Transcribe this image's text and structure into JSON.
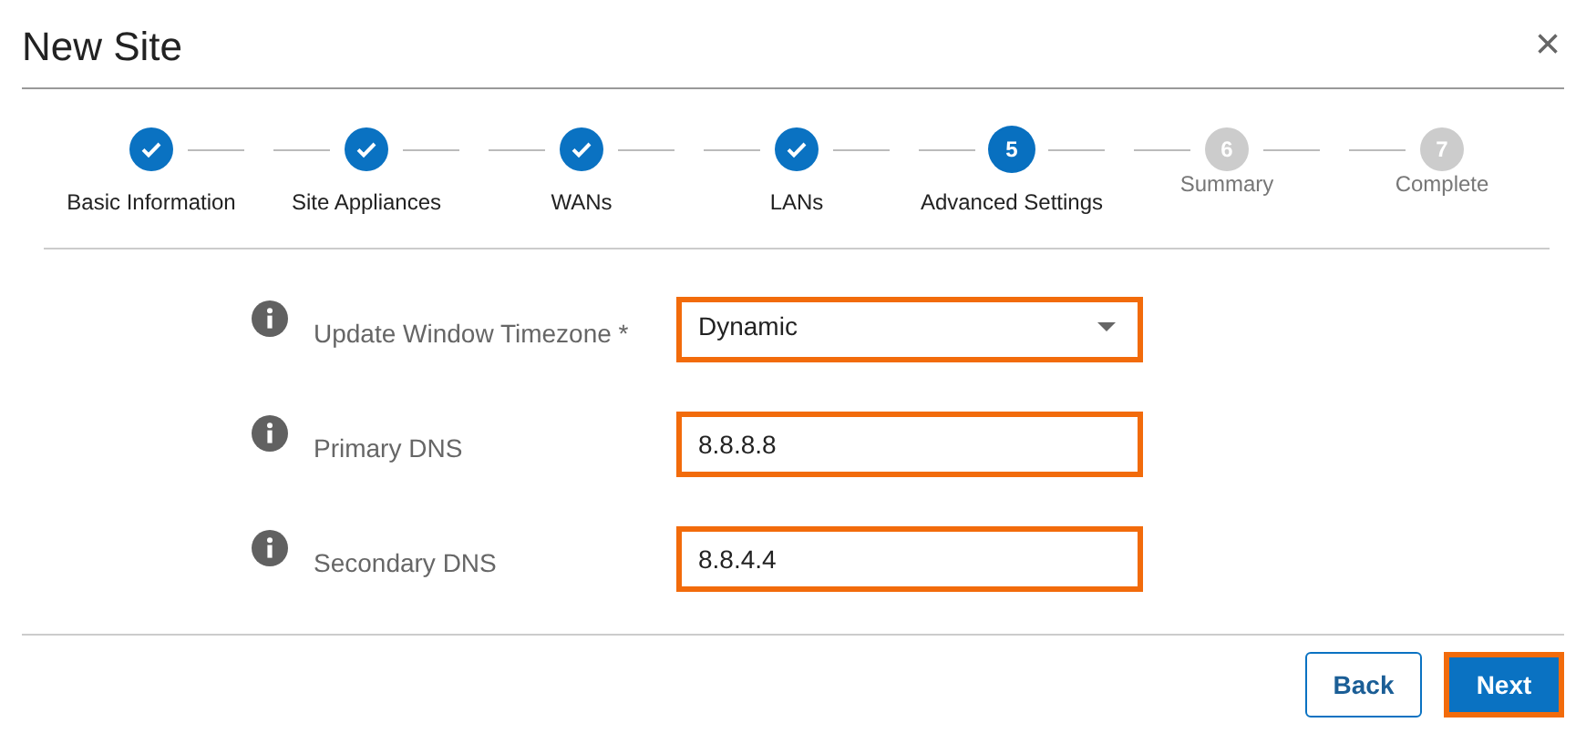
{
  "dialog": {
    "title": "New Site",
    "close": "×"
  },
  "steps": [
    {
      "label": "Basic Information",
      "completed": true,
      "current": false
    },
    {
      "label": "Site Appliances",
      "completed": true,
      "current": false
    },
    {
      "label": "WANs",
      "completed": true,
      "current": false
    },
    {
      "label": "LANs",
      "completed": true,
      "current": false
    },
    {
      "number": "5",
      "label": "Advanced Settings",
      "completed": false,
      "current": true
    },
    {
      "number": "6",
      "label": "Summary",
      "completed": false,
      "current": false
    },
    {
      "number": "7",
      "label": "Complete",
      "completed": false,
      "current": false
    }
  ],
  "fields": [
    {
      "kind": "dropdown",
      "label": "Update Window Timezone *",
      "value": "Dynamic",
      "highlighted": true
    },
    {
      "kind": "text",
      "label": "Primary DNS",
      "value": "8.8.8.8",
      "highlighted": true
    },
    {
      "kind": "text",
      "label": "Secondary DNS",
      "value": "8.8.4.4",
      "highlighted": true
    }
  ],
  "buttons": [
    {
      "kind": "secondary",
      "label": "Back",
      "highlighted": false
    },
    {
      "kind": "primary",
      "label": "Next",
      "highlighted": true
    }
  ]
}
